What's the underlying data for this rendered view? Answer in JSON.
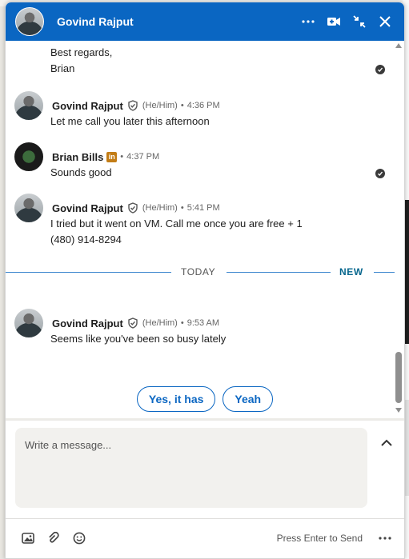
{
  "header": {
    "name": "Govind Rajput"
  },
  "messages": {
    "top_text_1": "Best regards,",
    "top_text_2": "Brian",
    "m1": {
      "sender": "Govind Rajput",
      "pronouns": "(He/Him)",
      "time": "4:36 PM",
      "text": "Let me call you later this afternoon"
    },
    "m2": {
      "sender": "Brian Bills",
      "badge": "in",
      "time": "4:37 PM",
      "text": "Sounds good"
    },
    "m3": {
      "sender": "Govind Rajput",
      "pronouns": "(He/Him)",
      "time": "5:41 PM",
      "text_line1": "I tried but it went on VM. Call me once you are free + 1",
      "text_line2": "(480) 914-8294"
    },
    "divider": {
      "today": "TODAY",
      "new": "NEW"
    },
    "m4": {
      "sender": "Govind Rajput",
      "pronouns": "(He/Him)",
      "time": "9:53 AM",
      "text": "Seems like you've been so busy lately"
    },
    "dot": "•"
  },
  "suggestions": [
    "Yes, it has",
    "Yeah"
  ],
  "composer": {
    "placeholder": "Write a message...",
    "press_enter": "Press Enter to Send"
  },
  "icons": {
    "header": [
      "more-icon",
      "video-call-icon",
      "minimize-icon",
      "close-icon"
    ],
    "footer": [
      "image-icon",
      "attach-icon",
      "emoji-icon",
      "more-icon"
    ]
  },
  "colors": {
    "brand": "#0a66c2",
    "badge": "#c37d16",
    "new": "#05668d"
  }
}
